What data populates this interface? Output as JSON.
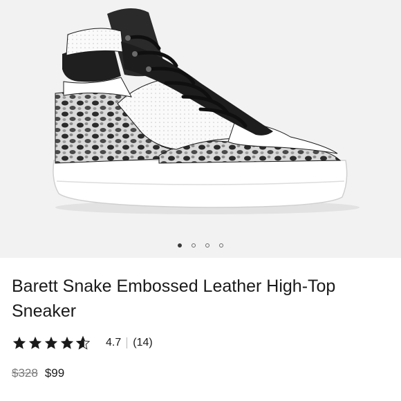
{
  "product": {
    "title": "Barett Snake Embossed Leather High-Top Sneaker",
    "image_icon": "sneaker-image",
    "carousel": {
      "total": 4,
      "active_index": 0
    },
    "rating": {
      "value": "4.7",
      "stars": 4.7,
      "count": "(14)"
    },
    "price": {
      "original": "$328",
      "sale": "$99"
    }
  },
  "colors": {
    "hero_background": "#f2f2f2",
    "text": "#1a1a1a",
    "muted": "#7a7a7a"
  }
}
